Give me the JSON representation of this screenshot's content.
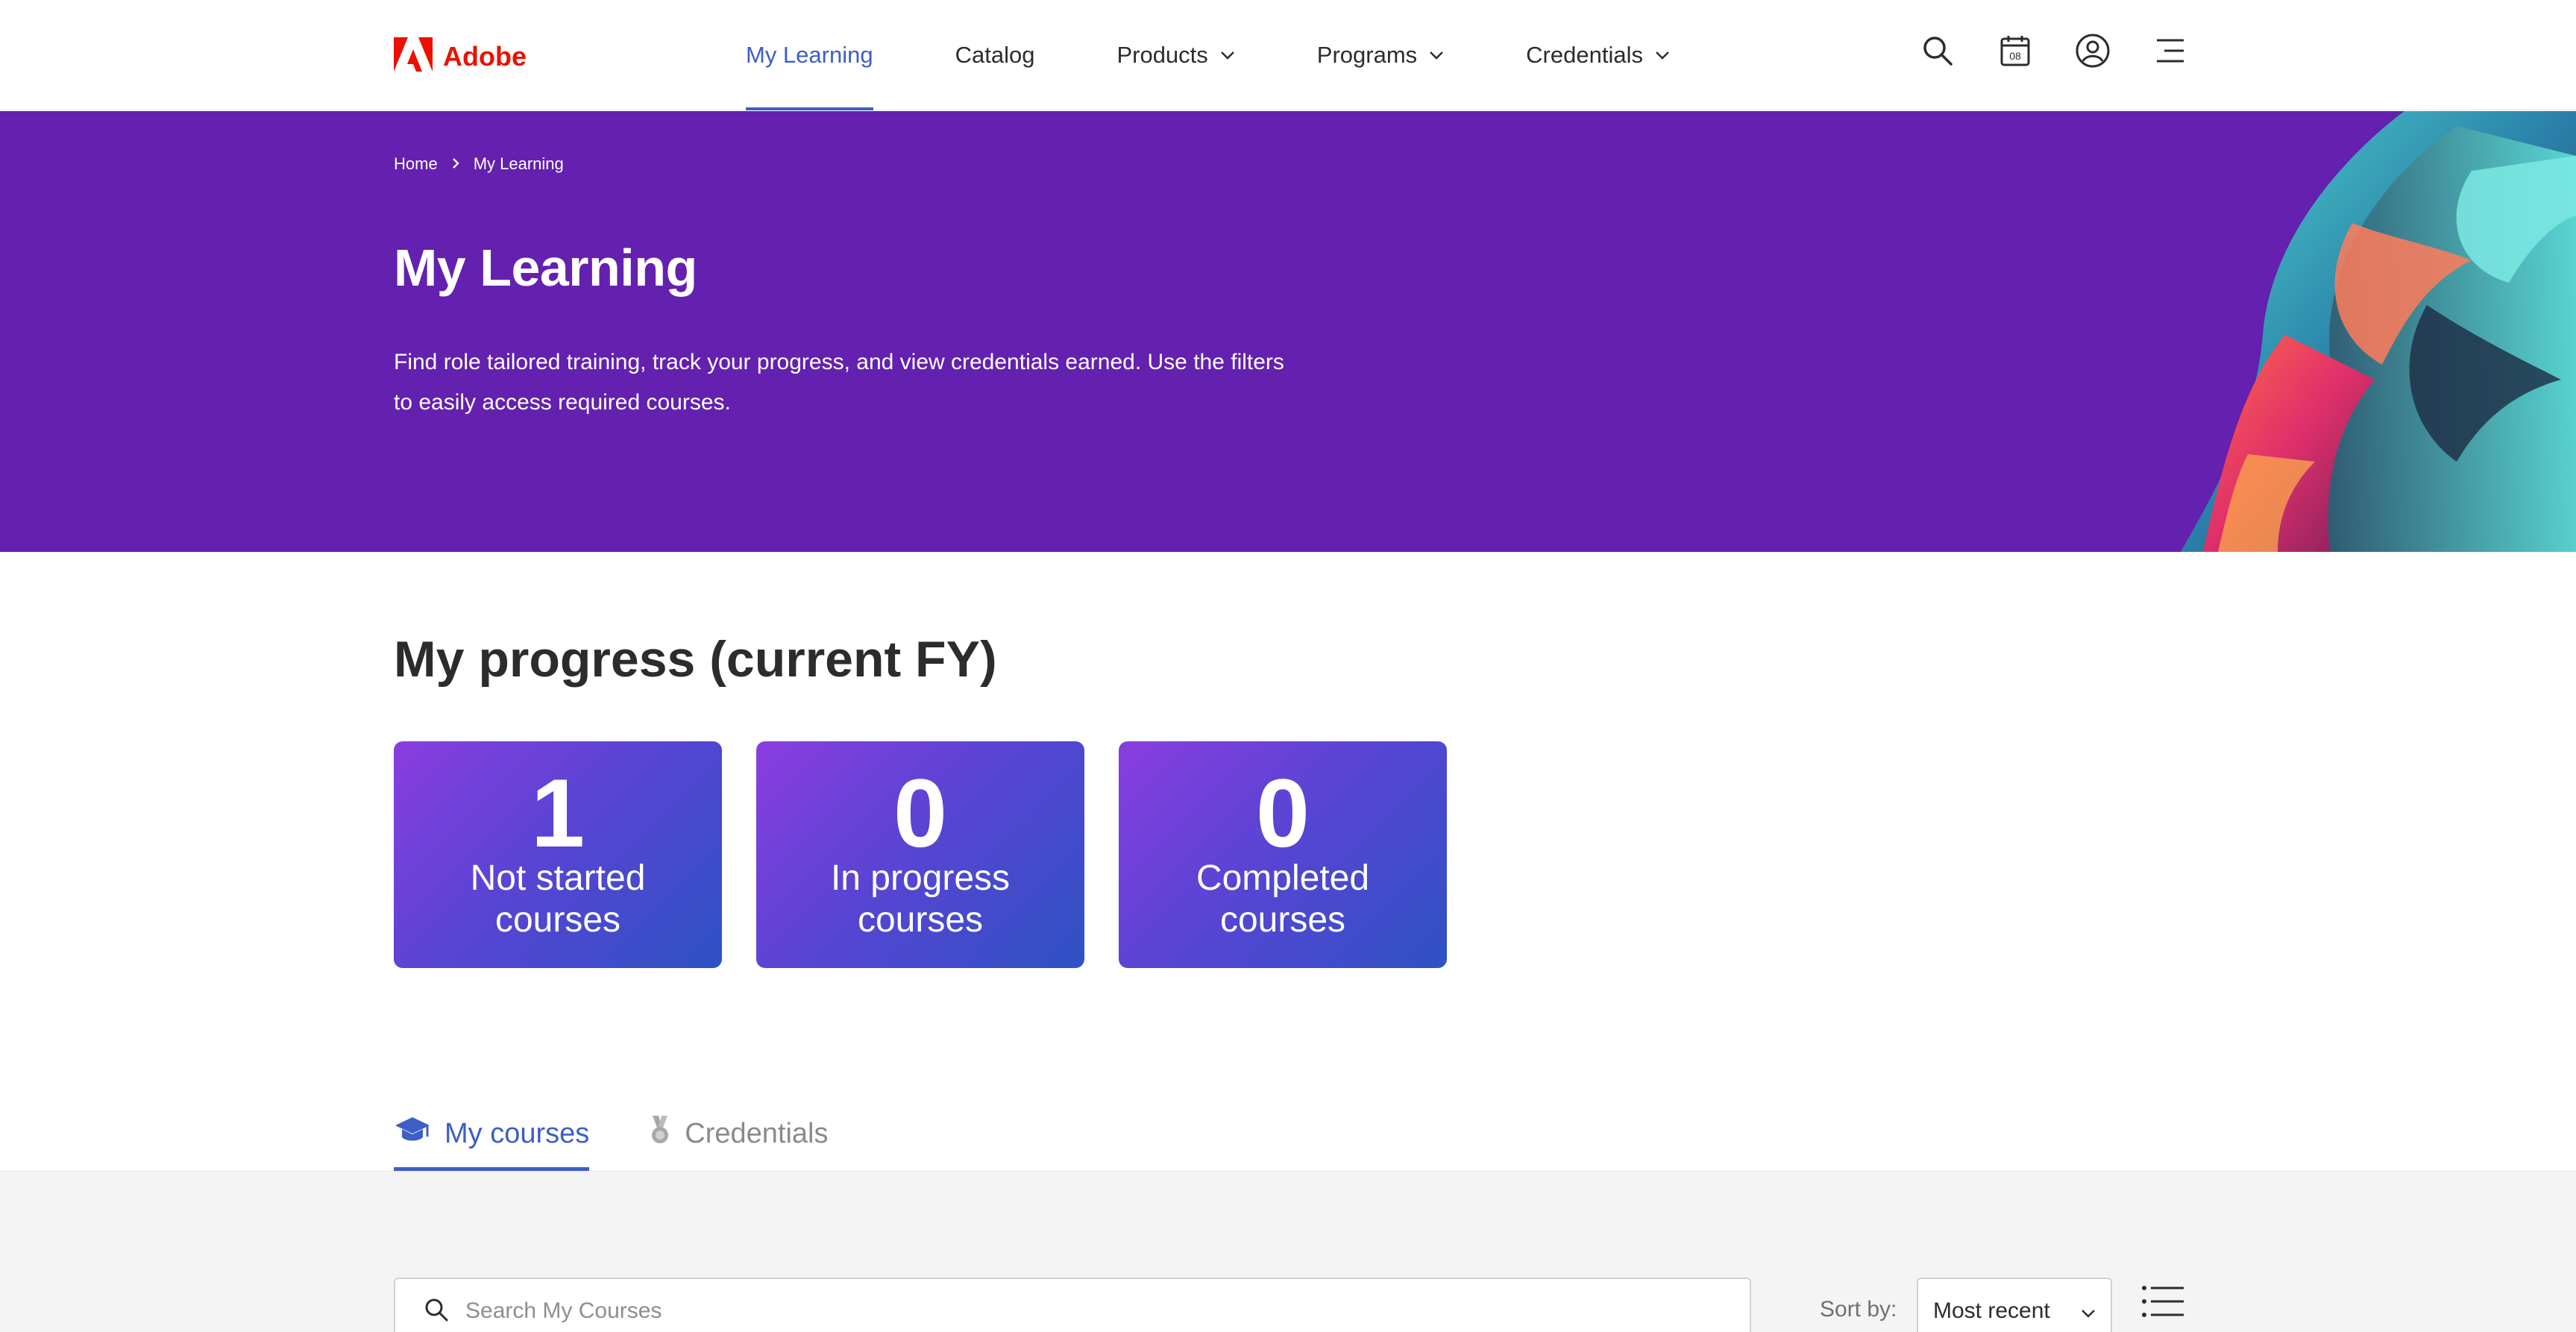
{
  "brand": {
    "name": "Adobe",
    "color": "#eb1000"
  },
  "nav": {
    "items": [
      {
        "label": "My Learning",
        "active": true,
        "dropdown": false
      },
      {
        "label": "Catalog",
        "active": false,
        "dropdown": false
      },
      {
        "label": "Products",
        "active": false,
        "dropdown": true
      },
      {
        "label": "Programs",
        "active": false,
        "dropdown": true
      },
      {
        "label": "Credentials",
        "active": false,
        "dropdown": true
      }
    ],
    "icons": [
      "search-icon",
      "calendar-icon",
      "user-account-icon",
      "menu-icon"
    ],
    "calendar_day": "08",
    "accent_color": "#3d5ec7"
  },
  "breadcrumb": {
    "home": "Home",
    "current": "My Learning"
  },
  "hero": {
    "title": "My Learning",
    "description": "Find role tailored training, track your progress, and view credentials earned. Use the filters to easily access required courses.",
    "background_color": "#6420ae"
  },
  "progress": {
    "title": "My progress (current FY)",
    "cards": [
      {
        "count": "1",
        "line1": "Not started",
        "line2": "courses"
      },
      {
        "count": "0",
        "line1": "In progress",
        "line2": "courses"
      },
      {
        "count": "0",
        "line1": "Completed",
        "line2": "courses"
      }
    ]
  },
  "tabs": [
    {
      "label": "My courses",
      "icon": "graduation-cap-icon",
      "active": true
    },
    {
      "label": "Credentials",
      "icon": "medal-icon",
      "active": false
    }
  ],
  "courses": {
    "search_placeholder": "Search My Courses",
    "sort_label": "Sort by:",
    "sort_value": "Most recent"
  }
}
